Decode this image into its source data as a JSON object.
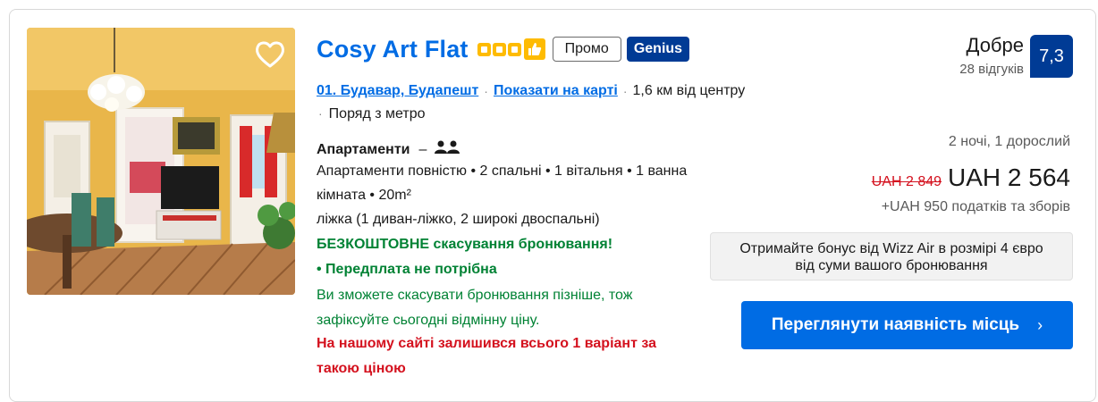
{
  "property": {
    "name": "Cosy Art Flat",
    "rating_stars": 3,
    "badges": {
      "promo": "Промо",
      "genius": "Genius"
    },
    "district_link": "01. Будавар, Будапешт",
    "map_link": "Показати на карті",
    "distance": "1,6 км від центру",
    "metro": "Поряд з метро"
  },
  "room": {
    "title": "Апартаменти",
    "dash": "–",
    "occupancy_icon": "two-persons-icon",
    "description": "Апартаменти повністю • 2 спальні • 1 вітальня • 1 ванна кімната • 20m²",
    "beds": "ліжка (1 диван-ліжко, 2 широкі двоспальні)",
    "free_cancellation": "БЕЗКОШТОВНЕ скасування бронювання!",
    "no_prepayment": "• Передплата не потрібна",
    "cancel_later": "Ви зможете скасувати бронювання пізніше, тож зафіксуйте сьогодні відмінну ціну.",
    "scarcity": "На нашому сайті залишився всього 1 варіант за такою ціною"
  },
  "review": {
    "word": "Добре",
    "count": "28 відгуків",
    "score": "7,3"
  },
  "pricing": {
    "stay_info": "2 ночі, 1 дорослий",
    "old_price": "UAH 2 849",
    "new_price": "UAH 2 564",
    "taxes": "+UAH 950 податків та зборів",
    "wizz_offer": "Отримайте бонус від Wizz Air в розмірі 4 євро від суми вашого бронювання",
    "cta_label": "Переглянути наявність місць",
    "cta_icon": "chevron-right-icon"
  },
  "colors": {
    "link_blue": "#006ce4",
    "genius_blue": "#003b95",
    "star_yellow": "#febb02",
    "green": "#008234",
    "red": "#d4111e"
  }
}
